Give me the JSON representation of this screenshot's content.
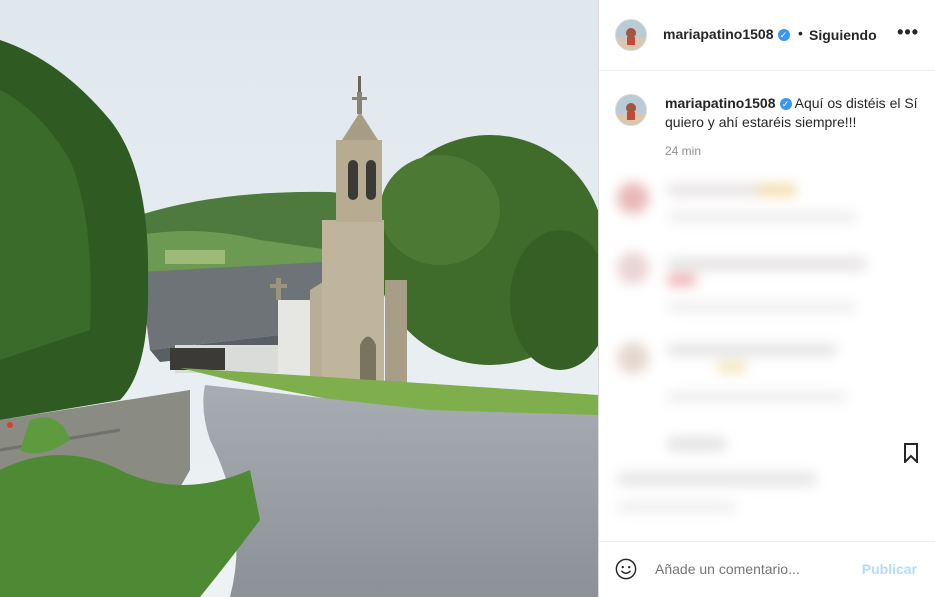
{
  "post": {
    "username": "mariapatino1508",
    "follow_status": "Siguiendo",
    "separator": "•",
    "more_label": "•••",
    "caption": "Aquí os distéis el Sí quiero y ahí estaréis siempre!!!",
    "time_ago": "24 min"
  },
  "comment_box": {
    "placeholder": "Añade un comentario...",
    "publish_label": "Publicar"
  },
  "icons": {
    "verified": "verified-badge-icon",
    "more": "more-options-icon",
    "emoji": "emoji-icon",
    "bookmark": "bookmark-icon"
  },
  "colors": {
    "verified_blue": "#3897f0",
    "publish_disabled": "#b3dbff",
    "secondary_text": "#8e8e8e"
  }
}
